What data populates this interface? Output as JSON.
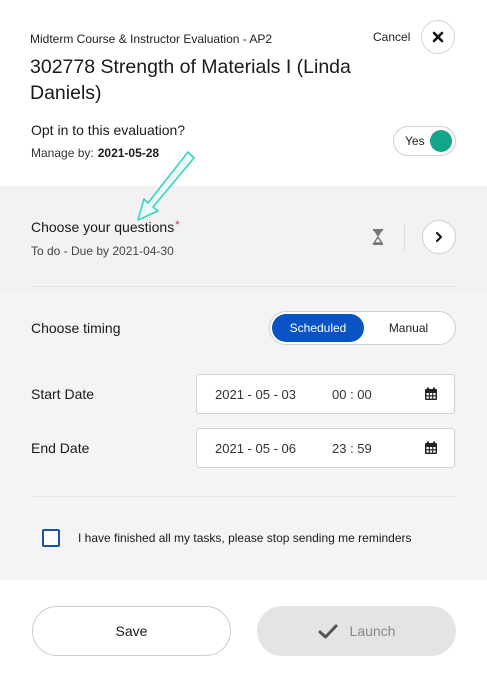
{
  "header": {
    "evaluation_title": "Midterm Course & Instructor Evaluation - AP2",
    "cancel_label": "Cancel",
    "course_title": "302778 Strength of Materials I (Linda Daniels)",
    "optin_label": "Opt in to this evaluation?",
    "manage_by_label": "Manage by:",
    "manage_by_date": "2021-05-28",
    "toggle_label": "Yes",
    "toggle_on": true,
    "toggle_color": "#13a48a"
  },
  "questions": {
    "title": "Choose your questions",
    "required_marker": "*",
    "status": "To do - Due by 2021-04-30"
  },
  "timing": {
    "label": "Choose timing",
    "options": [
      "Scheduled",
      "Manual"
    ],
    "selected": "Scheduled",
    "accent": "#0a53c4"
  },
  "dates": {
    "start": {
      "label": "Start Date",
      "date": "2021 - 05 - 03",
      "time": "00 : 00"
    },
    "end": {
      "label": "End Date",
      "date": "2021 - 05 - 06",
      "time": "23 : 59"
    }
  },
  "reminder": {
    "label": "I have finished all my tasks, please stop sending me reminders",
    "checked": false
  },
  "footer": {
    "save_label": "Save",
    "launch_label": "Launch"
  },
  "icons": [
    "close-icon",
    "hourglass-icon",
    "chevron-right-icon",
    "calendar-icon",
    "check-icon",
    "annotation-arrow-icon"
  ]
}
